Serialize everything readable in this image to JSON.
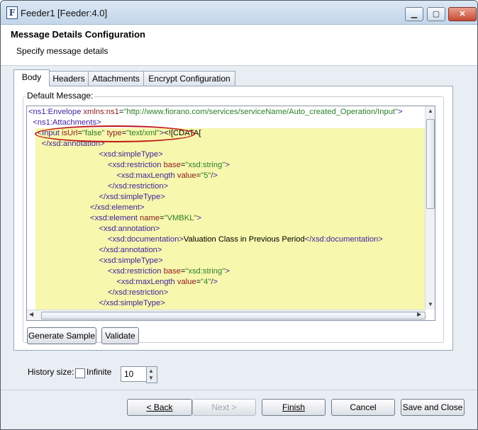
{
  "window": {
    "title": "Feeder1 [Feeder:4.0]",
    "icon_letter": "F",
    "min_glyph": "▁",
    "max_glyph": "▢",
    "close_glyph": "✕"
  },
  "header": {
    "title": "Message Details Configuration",
    "subtitle": "Specify message details"
  },
  "tabs": [
    {
      "label": "Body",
      "active": true
    },
    {
      "label": "Headers",
      "active": false
    },
    {
      "label": "Attachments",
      "active": false
    },
    {
      "label": "Encrypt Configuration",
      "active": false
    }
  ],
  "body": {
    "default_message_label": "Default Message:",
    "editor_lines": [
      "<ns1:Envelope xmlns:ns1=\"http://www.fiorano.com/services/serviceName/Auto_created_Operation/Input\">",
      "  <ns1:Attachments>",
      "    <Input isUrl=\"false\" type=\"text/xml\"><![CDATA[",
      "      </xsd:annotation>",
      "                                <xsd:simpleType>",
      "                                    <xsd:restriction base=\"xsd:string\">",
      "                                        <xsd:maxLength value=\"5\"/>",
      "                                    </xsd:restriction>",
      "                                </xsd:simpleType>",
      "                            </xsd:element>",
      "                            <xsd:element name=\"VMBKL\">",
      "                                <xsd:annotation>",
      "                                    <xsd:documentation>Valuation Class in Previous Period</xsd:documentation>",
      "                                </xsd:annotation>",
      "                                <xsd:simpleType>",
      "                                    <xsd:restriction base=\"xsd:string\">",
      "                                        <xsd:maxLength value=\"4\"/>",
      "                                    </xsd:restriction>",
      "                                </xsd:simpleType>"
    ],
    "generate_sample_label": "Generate Sample",
    "validate_label": "Validate"
  },
  "history": {
    "label": "History size:",
    "infinite_label": "Infinite",
    "infinite_checked": false,
    "value": "10"
  },
  "footer": {
    "back_label": "< Back",
    "next_label": "Next >",
    "finish_label": "Finish",
    "cancel_label": "Cancel",
    "save_close_label": "Save and Close"
  },
  "colors": {
    "highlight": "#f7f7ad",
    "tag": "#3f1f9b",
    "attr": "#8b1d20",
    "value": "#2a7f2a",
    "annotation_ring": "#c01818"
  }
}
